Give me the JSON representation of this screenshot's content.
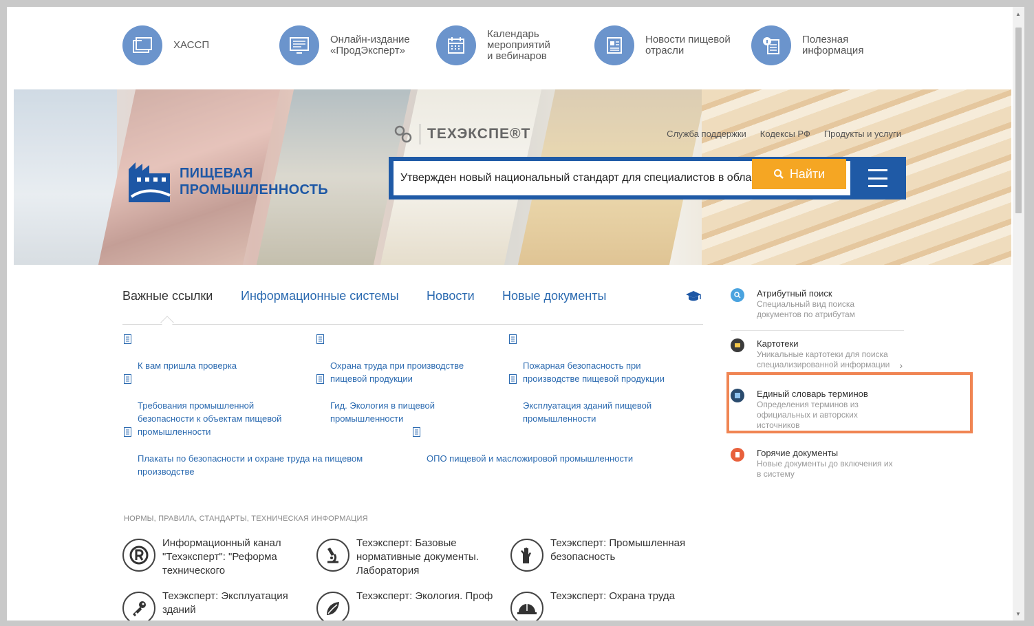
{
  "topnav": [
    {
      "label": "ХАССП",
      "icon": "folders-icon"
    },
    {
      "label": "Онлайн-издание\n«ПродЭксперт»",
      "icon": "monitor-icon"
    },
    {
      "label": "Календарь\nмероприятий\nи вебинаров",
      "icon": "calendar-icon"
    },
    {
      "label": "Новости пищевой\nотрасли",
      "icon": "newspaper-icon"
    },
    {
      "label": "Полезная\nинформация",
      "icon": "info-document-icon"
    }
  ],
  "banner": {
    "logo_text": "ПИЩЕВАЯ\nПРОМЫШЛЕННОСТЬ",
    "brand_name": "ТЕХЭКСПЕ®Т",
    "links": [
      "Служба поддержки",
      "Кодексы РФ",
      "Продукты и услуги"
    ],
    "search_value": "Утвержден новый национальный стандарт для специалистов в обла",
    "search_button": "Найти"
  },
  "tabs": [
    "Важные ссылки",
    "Информационные системы",
    "Новости",
    "Новые документы"
  ],
  "links": [
    "К вам пришла проверка",
    "Охрана труда при производстве\nпищевой продукции",
    "Пожарная безопасность при\nпроизводстве пищевой продукции",
    "Требования промышленной\nбезопасности к объектам пищевой\nпромышленности",
    "Гид. Экология в пищевой\nпромышленности",
    "Эксплуатация зданий пищевой\nпромышленности",
    "Плакаты по безопасности и охране труда на пищевом\nпроизводстве",
    "ОПО пищевой и масложировой промышленности"
  ],
  "section_title": "НОРМЫ, ПРАВИЛА, СТАНДАРТЫ, ТЕХНИЧЕСКАЯ ИНФОРМАЦИЯ",
  "products": [
    {
      "label": "Информационный канал\n\"Техэксперт\": \"Реформа\nтехнического",
      "icon": "registered-icon"
    },
    {
      "label": "Техэксперт: Базовые\nнормативные документы.\nЛаборатория",
      "icon": "microscope-icon"
    },
    {
      "label": "Техэксперт: Промышленная\nбезопасность",
      "icon": "gloves-icon"
    },
    {
      "label": "Техэксперт: Эксплуатация\nзданий",
      "icon": "key-icon"
    },
    {
      "label": "Техэксперт: Экология. Проф",
      "icon": "leaf-icon"
    },
    {
      "label": "Техэксперт: Охрана труда",
      "icon": "helmet-icon"
    }
  ],
  "sidebar": [
    {
      "title": "Атрибутный поиск",
      "desc": "Специальный вид поиска\nдокументов по атрибутам",
      "icon": "attribute-search-icon",
      "color": "#4aa3df"
    },
    {
      "title": "Картотеки",
      "desc": "Уникальные картотеки для поиска\nспециализированной информации",
      "icon": "card-index-icon",
      "color": "#3b3b3b"
    },
    {
      "title": "Единый словарь терминов",
      "desc": "Определения терминов из\nофициальных и авторских\nисточников",
      "icon": "dictionary-icon",
      "color": "#2a4b6e"
    },
    {
      "title": "Горячие документы",
      "desc": "Новые документы до включения их\nв систему",
      "icon": "hot-documents-icon",
      "color": "#e8603c"
    }
  ],
  "colors": {
    "accent": "#2b6ab0",
    "search_bg": "#1f5aa6",
    "button": "#f5a623",
    "highlight": "#f08553",
    "nav_circle": "#6b94cc"
  }
}
